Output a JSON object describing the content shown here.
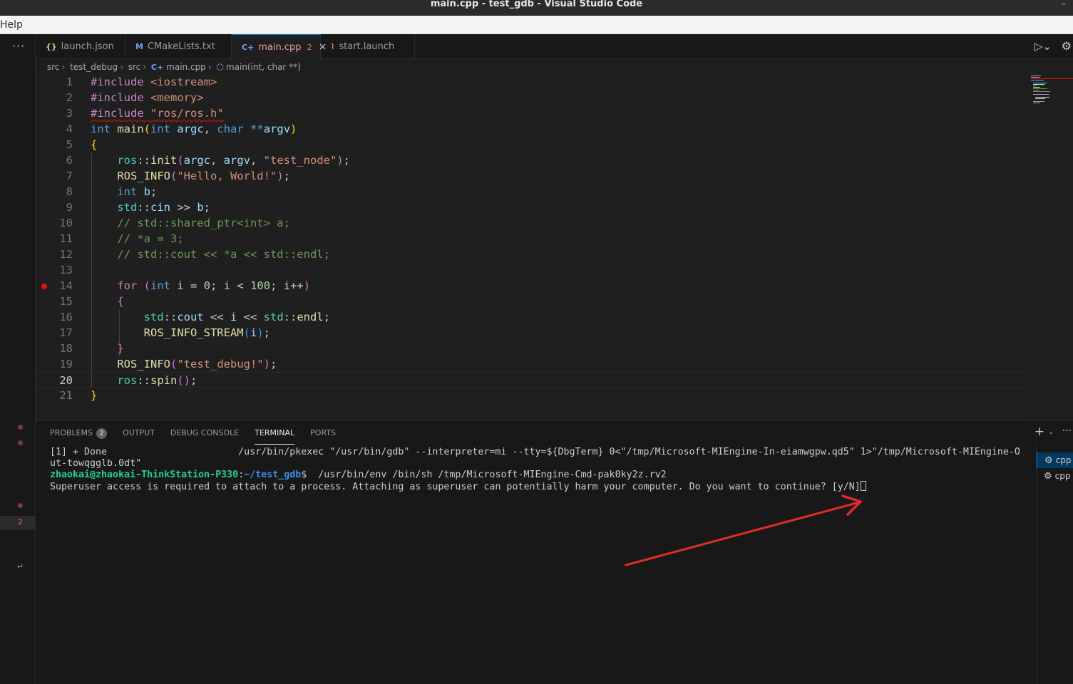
{
  "window": {
    "title": "main.cpp - test_gdb - Visual Studio Code",
    "minimize_glyph": "–"
  },
  "menubar": {
    "help_label": "Help"
  },
  "activity": {
    "more_glyph": "···",
    "badge_count": "2",
    "enter_glyph": "↵"
  },
  "tabs": [
    {
      "icon": "{}",
      "label": "launch.json",
      "icon_color": "#e2c08d"
    },
    {
      "icon": "M",
      "label": "CMakeLists.txt",
      "icon_color": "#6c9ef8"
    },
    {
      "icon": "C+",
      "label": "main.cpp",
      "badge": "2",
      "close": "×",
      "icon_color": "#e57272"
    },
    {
      "icon": "⌇",
      "label": "start.launch",
      "icon_color": "#f08d49"
    }
  ],
  "breadcrumb": [
    "src",
    "test_debug",
    "src",
    "main.cpp",
    "main(int, char **)"
  ],
  "editor": {
    "line_numbers": [
      "1",
      "2",
      "3",
      "4",
      "5",
      "6",
      "7",
      "8",
      "9",
      "10",
      "11",
      "12",
      "13",
      "14",
      "15",
      "16",
      "17",
      "18",
      "19",
      "20",
      "21"
    ],
    "current_line": 20,
    "breakpoint_line": 14
  },
  "panel": {
    "tabs": [
      {
        "label": "PROBLEMS",
        "badge": "2"
      },
      {
        "label": "OUTPUT"
      },
      {
        "label": "DEBUG CONSOLE"
      },
      {
        "label": "TERMINAL",
        "active": true
      },
      {
        "label": "PORTS"
      }
    ],
    "terminal": {
      "line1": "[1] + Done                       /usr/bin/pkexec \"/usr/bin/gdb\" --interpreter=mi --tty=${DbgTerm} 0<\"/tmp/Microsoft-MIEngine-In-eiamwgpw.qd5\" 1>\"/tmp/Microsoft-MIEngine-O",
      "line2": "ut-towqgglb.0dt\"",
      "prompt_user": "zhaokai@zhaokai-ThinkStation-P330",
      "prompt_path": "~/test_gdb",
      "prompt_cmd": "$  /usr/bin/env /bin/sh /tmp/Microsoft-MIEngine-Cmd-pak0ky2z.rv2",
      "line4": "Superuser access is required to attach to a process. Attaching as superuser can potentially harm your computer. Do you want to continue? [y/N]"
    },
    "instances": [
      "cpp",
      "cpp"
    ]
  },
  "colors": {
    "editor_bg": "#1f1f1f",
    "panel_bg": "#181818",
    "accent": "#0078d4",
    "error": "#e51400",
    "annotation_arrow": "#e02b2b"
  }
}
